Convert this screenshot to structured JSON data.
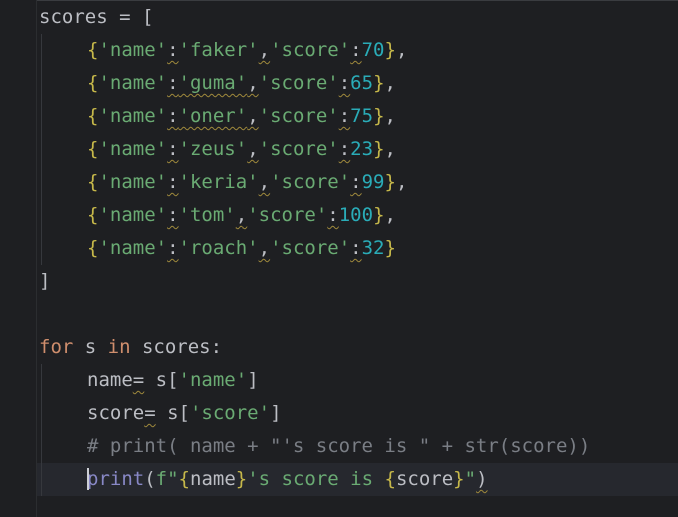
{
  "editor": {
    "lines": [
      {
        "indent": 0,
        "tokens": [
          {
            "t": "scores = [",
            "c": ""
          }
        ]
      },
      {
        "indent": 1,
        "tokens": [
          {
            "t": "{",
            "c": "brace"
          },
          {
            "t": "'name'",
            "c": "str"
          },
          {
            "t": ":",
            "c": "wavy"
          },
          {
            "t": "'faker'",
            "c": "str"
          },
          {
            "t": ",",
            "c": "wavy"
          },
          {
            "t": "'score'",
            "c": "str"
          },
          {
            "t": ":",
            "c": "wavy"
          },
          {
            "t": "70",
            "c": "num"
          },
          {
            "t": "}",
            "c": "brace"
          },
          {
            "t": ",",
            "c": ""
          }
        ]
      },
      {
        "indent": 1,
        "tokens": [
          {
            "t": "{",
            "c": "brace"
          },
          {
            "t": "'name'",
            "c": "str"
          },
          {
            "t": ":",
            "c": "wavy"
          },
          {
            "t": "'guma'",
            "c": "str wavy"
          },
          {
            "t": ",",
            "c": "wavy"
          },
          {
            "t": "'score'",
            "c": "str"
          },
          {
            "t": ":",
            "c": "wavy"
          },
          {
            "t": "65",
            "c": "num"
          },
          {
            "t": "}",
            "c": "brace"
          },
          {
            "t": ",",
            "c": ""
          }
        ]
      },
      {
        "indent": 1,
        "tokens": [
          {
            "t": "{",
            "c": "brace"
          },
          {
            "t": "'name'",
            "c": "str"
          },
          {
            "t": ":",
            "c": "wavy"
          },
          {
            "t": "'oner'",
            "c": "str wavy"
          },
          {
            "t": ",",
            "c": "wavy"
          },
          {
            "t": "'score'",
            "c": "str"
          },
          {
            "t": ":",
            "c": "wavy"
          },
          {
            "t": "75",
            "c": "num"
          },
          {
            "t": "}",
            "c": "brace"
          },
          {
            "t": ",",
            "c": ""
          }
        ]
      },
      {
        "indent": 1,
        "tokens": [
          {
            "t": "{",
            "c": "brace"
          },
          {
            "t": "'name'",
            "c": "str"
          },
          {
            "t": ":",
            "c": "wavy"
          },
          {
            "t": "'zeus'",
            "c": "str"
          },
          {
            "t": ",",
            "c": "wavy"
          },
          {
            "t": "'score'",
            "c": "str"
          },
          {
            "t": ":",
            "c": "wavy"
          },
          {
            "t": "23",
            "c": "num"
          },
          {
            "t": "}",
            "c": "brace"
          },
          {
            "t": ",",
            "c": ""
          }
        ]
      },
      {
        "indent": 1,
        "tokens": [
          {
            "t": "{",
            "c": "brace"
          },
          {
            "t": "'name'",
            "c": "str"
          },
          {
            "t": ":",
            "c": "wavy"
          },
          {
            "t": "'keria'",
            "c": "str"
          },
          {
            "t": ",",
            "c": "wavy"
          },
          {
            "t": "'score'",
            "c": "str"
          },
          {
            "t": ":",
            "c": "wavy"
          },
          {
            "t": "99",
            "c": "num"
          },
          {
            "t": "}",
            "c": "brace"
          },
          {
            "t": ",",
            "c": ""
          }
        ]
      },
      {
        "indent": 1,
        "tokens": [
          {
            "t": "{",
            "c": "brace"
          },
          {
            "t": "'name'",
            "c": "str"
          },
          {
            "t": ":",
            "c": "wavy"
          },
          {
            "t": "'tom'",
            "c": "str"
          },
          {
            "t": ",",
            "c": "wavy"
          },
          {
            "t": "'score'",
            "c": "str"
          },
          {
            "t": ":",
            "c": "wavy"
          },
          {
            "t": "100",
            "c": "num"
          },
          {
            "t": "}",
            "c": "brace"
          },
          {
            "t": ",",
            "c": ""
          }
        ]
      },
      {
        "indent": 1,
        "tokens": [
          {
            "t": "{",
            "c": "brace"
          },
          {
            "t": "'name'",
            "c": "str"
          },
          {
            "t": ":",
            "c": "wavy"
          },
          {
            "t": "'roach'",
            "c": "str"
          },
          {
            "t": ",",
            "c": "wavy"
          },
          {
            "t": "'score'",
            "c": "str"
          },
          {
            "t": ":",
            "c": "wavy"
          },
          {
            "t": "32",
            "c": "num"
          },
          {
            "t": "}",
            "c": "brace"
          }
        ]
      },
      {
        "indent": 0,
        "tokens": [
          {
            "t": "]",
            "c": ""
          }
        ]
      },
      {
        "indent": 0,
        "tokens": []
      },
      {
        "indent": 0,
        "tokens": [
          {
            "t": "for",
            "c": "kw"
          },
          {
            "t": " s ",
            "c": ""
          },
          {
            "t": "in",
            "c": "kw"
          },
          {
            "t": " scores:",
            "c": ""
          }
        ]
      },
      {
        "indent": 1,
        "tokens": [
          {
            "t": "name",
            "c": ""
          },
          {
            "t": "=",
            "c": "wavy"
          },
          {
            "t": " s[",
            "c": ""
          },
          {
            "t": "'name'",
            "c": "str"
          },
          {
            "t": "]",
            "c": ""
          }
        ]
      },
      {
        "indent": 1,
        "tokens": [
          {
            "t": "score",
            "c": ""
          },
          {
            "t": "=",
            "c": "wavy"
          },
          {
            "t": " s[",
            "c": ""
          },
          {
            "t": "'score'",
            "c": "str"
          },
          {
            "t": "]",
            "c": ""
          }
        ]
      },
      {
        "indent": 1,
        "tokens": [
          {
            "t": "# print( name + \"'s score is \" + str(score))",
            "c": "cmt"
          }
        ]
      },
      {
        "indent": 1,
        "current": true,
        "tokens": [
          {
            "t": "print",
            "c": "builtin caretbefore"
          },
          {
            "t": "(",
            "c": ""
          },
          {
            "t": "f\"",
            "c": "fstr"
          },
          {
            "t": "{",
            "c": "brace"
          },
          {
            "t": "name",
            "c": "fvar"
          },
          {
            "t": "}",
            "c": "brace"
          },
          {
            "t": "'s score is ",
            "c": "fstr"
          },
          {
            "t": "{",
            "c": "brace"
          },
          {
            "t": "score",
            "c": "fvar"
          },
          {
            "t": "}",
            "c": "brace"
          },
          {
            "t": "\"",
            "c": "fstr"
          },
          {
            "t": ")",
            "c": "wavy"
          }
        ]
      }
    ]
  },
  "colors": {
    "background": "#1e1f22",
    "keyword": "#cf8e6d",
    "string": "#6aab73",
    "number": "#2aacb8",
    "comment": "#7a7e85",
    "brace": "#c6b84a",
    "builtin": "#8888c6"
  }
}
